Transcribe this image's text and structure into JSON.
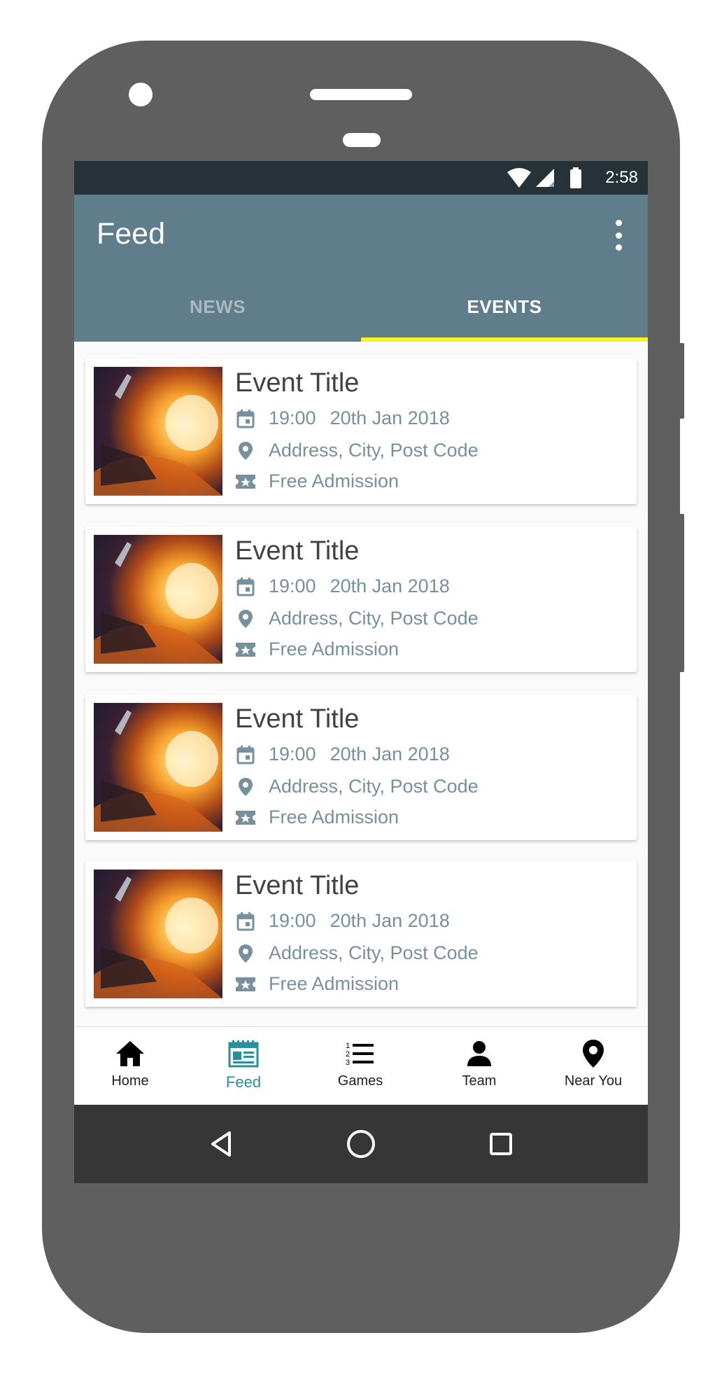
{
  "status_bar": {
    "time": "2:58",
    "icons": [
      "wifi-icon",
      "signal-icon",
      "battery-icon"
    ]
  },
  "app_bar": {
    "title": "Feed",
    "menu_icon": "more-vert-icon"
  },
  "tabs": [
    {
      "label": "NEWS",
      "active": false
    },
    {
      "label": "EVENTS",
      "active": true
    }
  ],
  "events": [
    {
      "title": "Event Title",
      "time": "19:00",
      "date": "20th Jan 2018",
      "address": "Address, City, Post Code",
      "admission": "Free Admission"
    },
    {
      "title": "Event Title",
      "time": "19:00",
      "date": "20th Jan 2018",
      "address": "Address, City, Post Code",
      "admission": "Free Admission"
    },
    {
      "title": "Event Title",
      "time": "19:00",
      "date": "20th Jan 2018",
      "address": "Address, City, Post Code",
      "admission": "Free Admission"
    },
    {
      "title": "Event Title",
      "time": "19:00",
      "date": "20th Jan 2018",
      "address": "Address, City, Post Code",
      "admission": "Free Admission"
    }
  ],
  "bottom_nav": [
    {
      "label": "Home",
      "icon": "home-icon",
      "active": false
    },
    {
      "label": "Feed",
      "icon": "feed-icon",
      "active": true
    },
    {
      "label": "Games",
      "icon": "list-icon",
      "active": false
    },
    {
      "label": "Team",
      "icon": "person-icon",
      "active": false
    },
    {
      "label": "Near You",
      "icon": "location-pin-icon",
      "active": false
    }
  ],
  "system_nav": [
    "back-icon",
    "home-circle-icon",
    "recents-icon"
  ],
  "colors": {
    "app_bar": "#607d8b",
    "status_bar": "#263238",
    "tab_indicator": "#f5f523",
    "active_nav": "#2b8f9b",
    "meta_text": "#78909c"
  }
}
